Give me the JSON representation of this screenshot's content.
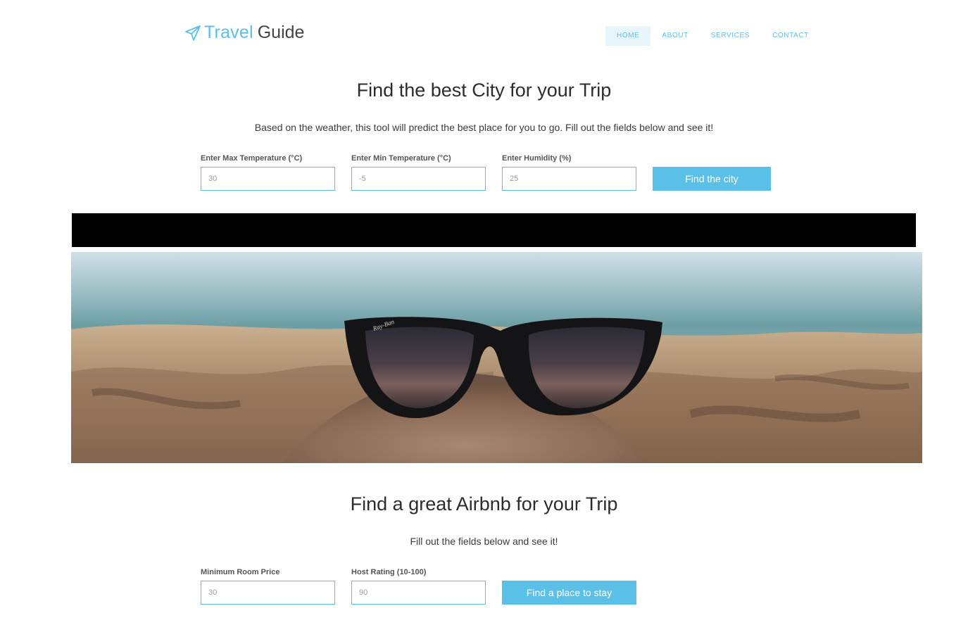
{
  "brand": {
    "icon": "paper-plane-icon",
    "name_part1": "Travel",
    "name_part2": "Guide",
    "colors": {
      "accent": "#5bc0e8",
      "dark": "#444444"
    }
  },
  "nav": {
    "items": [
      {
        "label": "HOME",
        "active": true
      },
      {
        "label": "ABOUT",
        "active": false
      },
      {
        "label": "SERVICES",
        "active": false
      },
      {
        "label": "CONTACT",
        "active": false
      }
    ]
  },
  "city_finder": {
    "title": "Find the best City for your Trip",
    "subtitle": "Based on the weather, this tool will predict the best place for you to go. Fill out the fields below and see it!",
    "fields": [
      {
        "label": "Enter Max Temperature (°C)",
        "placeholder": "30"
      },
      {
        "label": "Enter Min Temperature (°C)",
        "placeholder": "-5"
      },
      {
        "label": "Enter Humidity (%)",
        "placeholder": "25"
      }
    ],
    "button_label": "Find the city"
  },
  "hero": {
    "image": "sunglasses-on-beach-sand"
  },
  "airbnb_finder": {
    "title": "Find a great Airbnb for your Trip",
    "subtitle": "Fill out the fields below and see it!",
    "fields": [
      {
        "label": "Minimum Room Price",
        "placeholder": "30"
      },
      {
        "label": "Host Rating (10-100)",
        "placeholder": "90"
      }
    ],
    "button_label": "Find a place to stay"
  }
}
